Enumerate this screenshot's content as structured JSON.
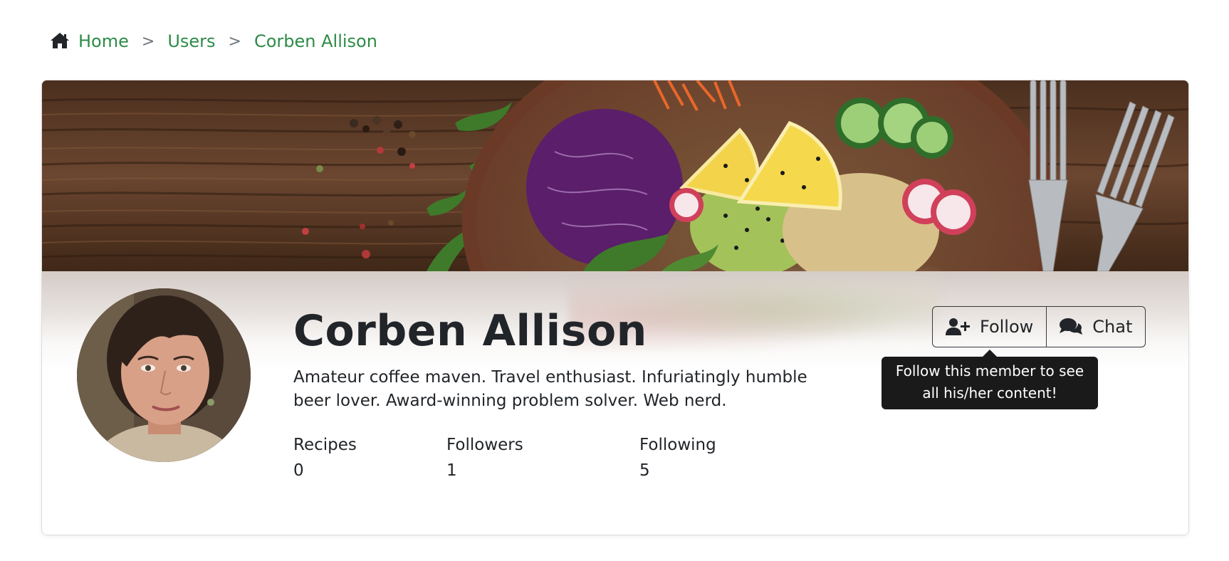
{
  "breadcrumb": {
    "home_icon": "home-icon",
    "items": [
      "Home",
      "Users",
      "Corben Allison"
    ],
    "separator": ">",
    "link_color": "#2e8b47"
  },
  "profile": {
    "name": "Corben Allison",
    "bio": "Amateur coffee maven. Travel enthusiast. Infuriatingly humble beer lover. Award-winning problem solver. Web nerd.",
    "banner": "banner-image",
    "avatar": "avatar-image",
    "stats": [
      {
        "label": "Recipes",
        "value": "0"
      },
      {
        "label": "Followers",
        "value": "1"
      },
      {
        "label": "Following",
        "value": "5"
      }
    ]
  },
  "actions": {
    "follow_label": "Follow",
    "follow_icon": "user-plus-icon",
    "chat_label": "Chat",
    "chat_icon": "comments-icon"
  },
  "tooltip": {
    "text": "Follow this member to see all his/her content!"
  }
}
